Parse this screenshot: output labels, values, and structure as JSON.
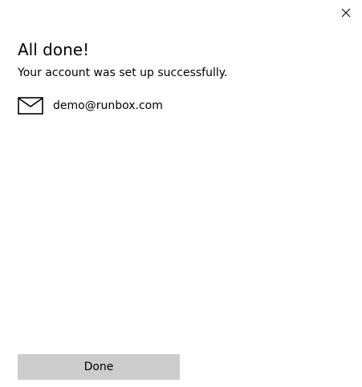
{
  "dialog": {
    "close_icon": "close-icon",
    "title": "All done!",
    "subtitle": "Your account was set up successfully.",
    "account": {
      "icon": "mail-icon",
      "email": "demo@runbox.com"
    },
    "done_button_label": "Done"
  },
  "colors": {
    "background": "#ffffff",
    "text": "#000000",
    "button_background": "#cccccc"
  }
}
